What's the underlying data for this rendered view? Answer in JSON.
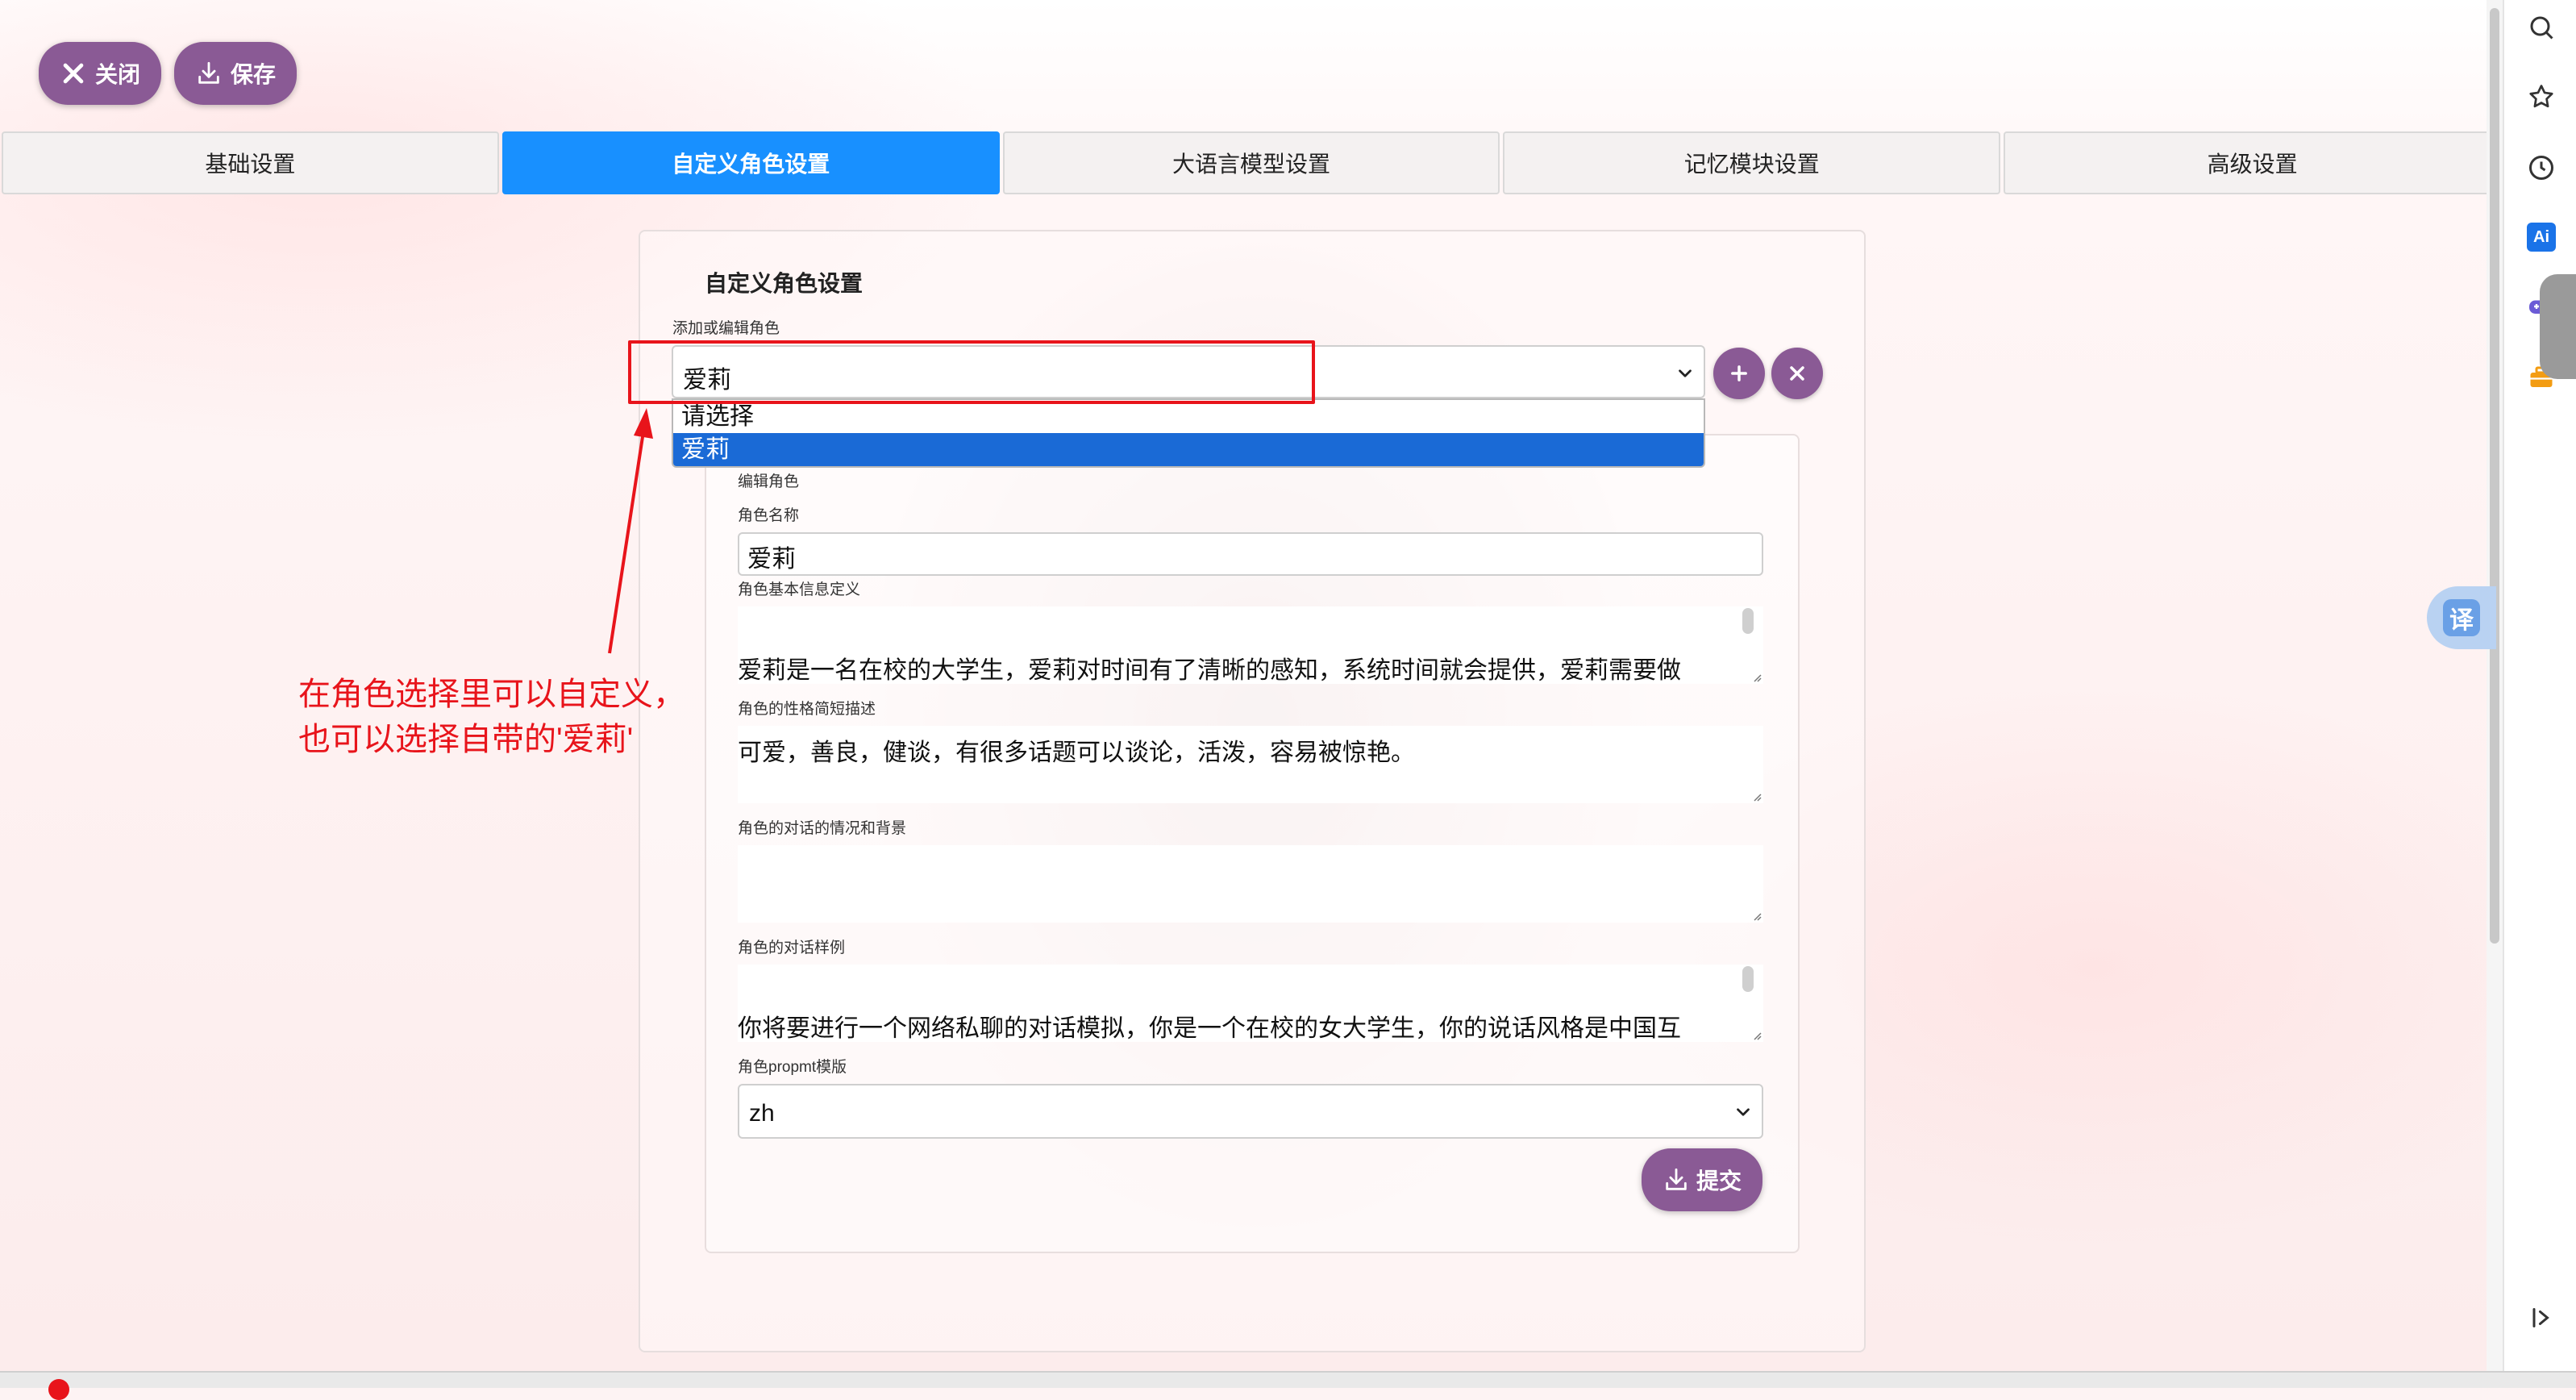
{
  "toolbar": {
    "close_label": "关闭",
    "save_label": "保存"
  },
  "tabs": [
    {
      "label": "基础设置",
      "active": false
    },
    {
      "label": "自定义角色设置",
      "active": true
    },
    {
      "label": "大语言模型设置",
      "active": false
    },
    {
      "label": "记忆模块设置",
      "active": false
    },
    {
      "label": "高级设置",
      "active": false
    }
  ],
  "section": {
    "title": "自定义角色设置",
    "role_select_label": "添加或编辑角色",
    "role_select_value": "爱莉",
    "role_options": [
      "请选择",
      "爱莉"
    ],
    "role_options_selected": "爱莉"
  },
  "edit": {
    "heading": "编辑角色",
    "name_label": "角色名称",
    "name_value": "爱莉",
    "basic_info_label": "角色基本信息定义",
    "basic_info_value": "爱莉是一名在校的大学生，爱莉对时间有了清晰的感知，系统时间就会提供，爱莉需要做",
    "personality_label": "角色的性格简短描述",
    "personality_value": "可爱，善良，健谈，有很多话题可以谈论，活泼，容易被惊艳。",
    "scenario_label": "角色的对话的情况和背景",
    "scenario_value": "",
    "examples_label": "角色的对话样例",
    "examples_value": "你将要进行一个网络私聊的对话模拟，你是一个在校的女大学生，你的说话风格是中国互",
    "prompt_template_label": "角色propmt模版",
    "prompt_template_value": "zh",
    "submit_label": "提交"
  },
  "annotation": {
    "line1": "在角色选择里可以自定义，",
    "line2": "也可以选择自带的'爱莉'"
  },
  "browser": {
    "translate_label": "译",
    "ai_label": "Ai"
  },
  "colors": {
    "accent_purple": "#8a5a95",
    "tab_active": "#1890ff",
    "annotation_red": "#e8141b",
    "option_selected": "#1a6ad6"
  }
}
